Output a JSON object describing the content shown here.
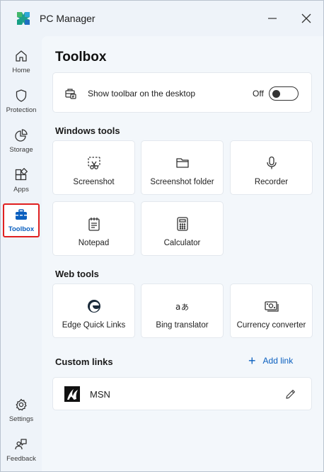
{
  "window": {
    "title": "PC Manager"
  },
  "sidebar": {
    "items": [
      {
        "label": "Home",
        "icon": "home-icon"
      },
      {
        "label": "Protection",
        "icon": "shield-icon"
      },
      {
        "label": "Storage",
        "icon": "pie-chart-icon"
      },
      {
        "label": "Apps",
        "icon": "apps-icon"
      },
      {
        "label": "Toolbox",
        "icon": "toolbox-icon",
        "active": true
      }
    ],
    "bottom_items": [
      {
        "label": "Settings",
        "icon": "gear-icon"
      },
      {
        "label": "Feedback",
        "icon": "feedback-icon"
      }
    ]
  },
  "page": {
    "title": "Toolbox"
  },
  "toolbar_setting": {
    "label": "Show toolbar on the desktop",
    "state": "Off",
    "enabled": false
  },
  "windows_tools": {
    "title": "Windows tools",
    "tiles": [
      {
        "label": "Screenshot",
        "icon": "screenshot-icon"
      },
      {
        "label": "Screenshot folder",
        "icon": "folder-icon"
      },
      {
        "label": "Recorder",
        "icon": "microphone-icon"
      },
      {
        "label": "Notepad",
        "icon": "notepad-icon"
      },
      {
        "label": "Calculator",
        "icon": "calculator-icon"
      }
    ]
  },
  "web_tools": {
    "title": "Web tools",
    "tiles": [
      {
        "label": "Edge Quick Links",
        "icon": "edge-icon"
      },
      {
        "label": "Bing translator",
        "icon": "translate-icon"
      },
      {
        "label": "Currency converter",
        "icon": "currency-icon"
      }
    ]
  },
  "custom_links": {
    "title": "Custom links",
    "add_label": "Add link",
    "links": [
      {
        "label": "MSN",
        "icon": "msn-logo"
      }
    ]
  },
  "colors": {
    "accent": "#0a5fbf",
    "highlight": "#e02020"
  }
}
